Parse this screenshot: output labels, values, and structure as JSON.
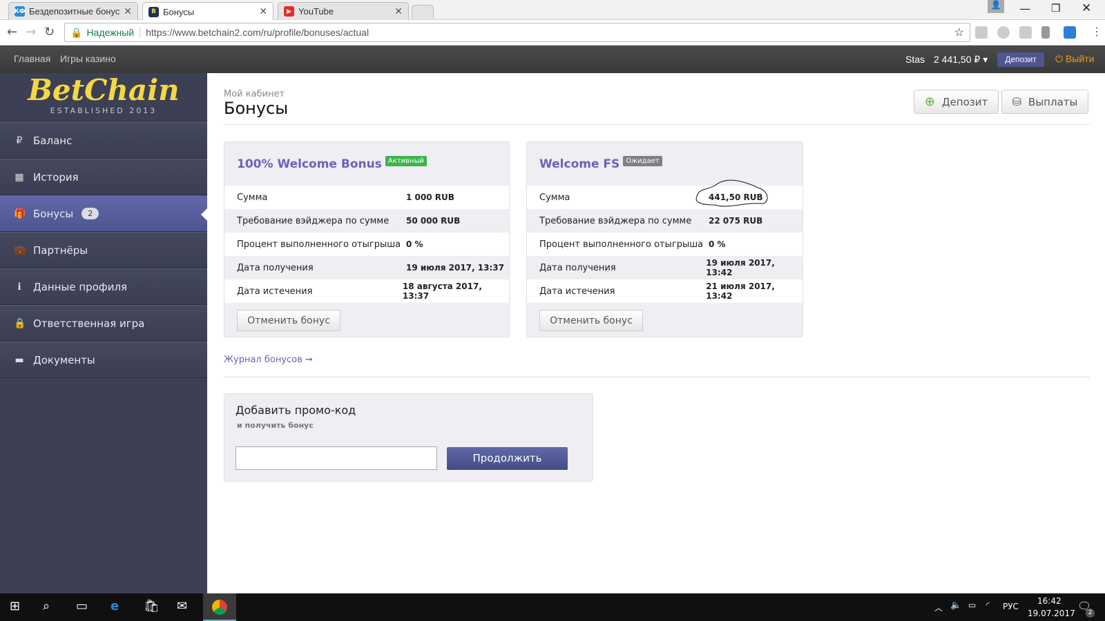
{
  "browser": {
    "tabs": [
      {
        "title": "Бездепозитные бонусы",
        "favicon": "КФ"
      },
      {
        "title": "Бонусы",
        "favicon": "B"
      },
      {
        "title": "YouTube",
        "favicon": "▶"
      }
    ],
    "secure_label": "Надежный",
    "url": "https://www.betchain2.com/ru/profile/bonuses/actual"
  },
  "sitenav": {
    "links": [
      "Главная",
      "Игры казино"
    ],
    "user": "Stas",
    "balance": "2 441,50 ₽",
    "deposit": "Депозит",
    "logout": "Выйти"
  },
  "logo": {
    "brand": "BetChain",
    "tagline": "ESTABLISHED 2013"
  },
  "sidebar": {
    "items": [
      {
        "label": "Баланс",
        "icon": "₽"
      },
      {
        "label": "История",
        "icon": "▦"
      },
      {
        "label": "Бонусы",
        "icon": "🎁",
        "badge": "2"
      },
      {
        "label": "Партнёры",
        "icon": "💼"
      },
      {
        "label": "Данные профиля",
        "icon": "ℹ"
      },
      {
        "label": "Ответственная игра",
        "icon": "🔒"
      },
      {
        "label": "Документы",
        "icon": "▬"
      }
    ]
  },
  "page": {
    "breadcrumb": "Мой кабинет",
    "title": "Бонусы",
    "deposit_btn": "Депозит",
    "payout_btn": "Выплаты"
  },
  "bonuses": [
    {
      "title": "100% Welcome Bonus",
      "status": "Активный",
      "status_color": "#3cb54a",
      "rows": [
        [
          "Сумма",
          "1 000 RUB"
        ],
        [
          "Требование вэйджера по сумме",
          "50 000 RUB"
        ],
        [
          "Процент выполненного отыгрыша",
          "0 %"
        ],
        [
          "Дата получения",
          "19 июля 2017, 13:37"
        ],
        [
          "Дата истечения",
          "18 августа 2017, 13:37"
        ]
      ],
      "cancel": "Отменить бонус"
    },
    {
      "title": "Welcome FS",
      "status": "Ожидает",
      "status_color": "#808080",
      "rows": [
        [
          "Сумма",
          "441,50 RUB"
        ],
        [
          "Требование вэйджера по сумме",
          "22 075 RUB"
        ],
        [
          "Процент выполненного отыгрыша",
          "0 %"
        ],
        [
          "Дата получения",
          "19 июля 2017, 13:42"
        ],
        [
          "Дата истечения",
          "21 июля 2017, 13:42"
        ]
      ],
      "cancel": "Отменить бонус"
    }
  ],
  "journal_link": "Журнал бонусов ➞",
  "promo": {
    "title": "Добавить промо-код",
    "subtitle": "и получить бонус",
    "input_value": "",
    "submit": "Продолжить"
  },
  "taskbar": {
    "lang": "РУС",
    "time": "16:42",
    "date": "19.07.2017",
    "notifications": "2"
  }
}
